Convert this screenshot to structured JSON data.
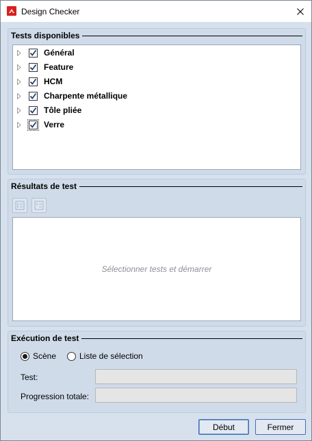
{
  "window": {
    "title": "Design Checker"
  },
  "available_tests": {
    "header": "Tests disponibles",
    "items": [
      {
        "label": "Général",
        "checked": true
      },
      {
        "label": "Feature",
        "checked": true
      },
      {
        "label": "HCM",
        "checked": true
      },
      {
        "label": "Charpente métallique",
        "checked": true
      },
      {
        "label": "Tôle pliée",
        "checked": true
      },
      {
        "label": "Verre",
        "checked": true
      }
    ]
  },
  "results": {
    "header": "Résultats de test",
    "empty_message": "Sélectionner tests et démarrer"
  },
  "execution": {
    "header": "Exécution de test",
    "radio_scene": "Scène",
    "radio_selection_list": "Liste de sélection",
    "selected_option": "Scène",
    "test_label": "Test:",
    "test_value": "",
    "progress_label": "Progression totale:",
    "progress_value": ""
  },
  "buttons": {
    "start": "Début",
    "close": "Fermer"
  }
}
